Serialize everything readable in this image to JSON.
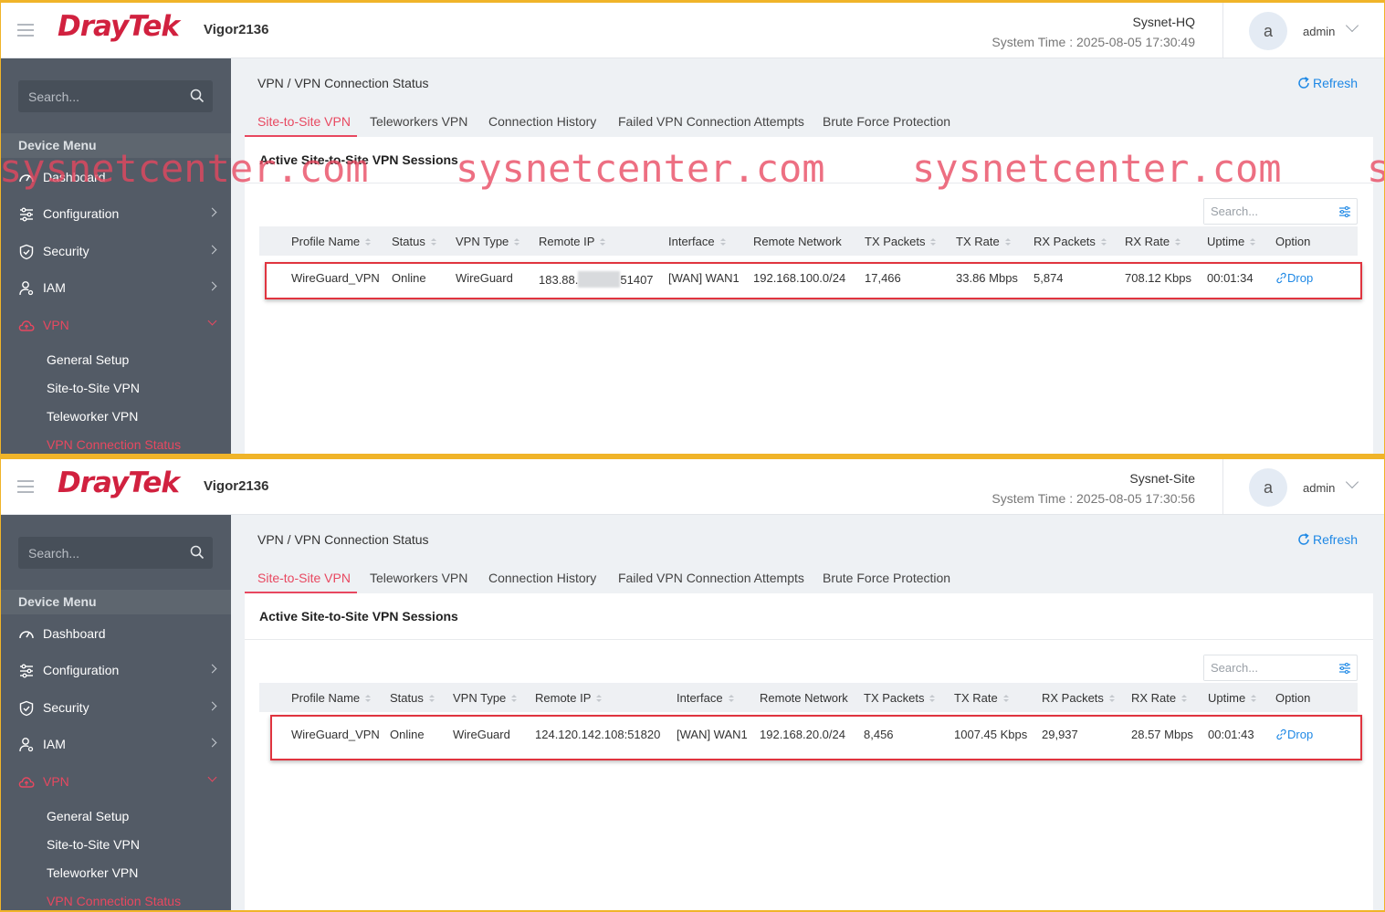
{
  "brand": {
    "logo": "DrayTek",
    "model": "Vigor2136"
  },
  "header": {
    "user_initial": "a",
    "user": "admin"
  },
  "sidebar": {
    "search_placeholder": "Search...",
    "section": "Device Menu",
    "items": [
      "Dashboard",
      "Configuration",
      "Security",
      "IAM",
      "VPN"
    ],
    "vpn_sub": [
      "General Setup",
      "Site-to-Site VPN",
      "Teleworker VPN",
      "VPN Connection Status"
    ]
  },
  "page": {
    "breadcrumb": "VPN / VPN Connection Status",
    "refresh": "Refresh",
    "tabs": [
      "Site-to-Site VPN",
      "Teleworkers VPN",
      "Connection History",
      "Failed VPN Connection Attempts",
      "Brute Force Protection"
    ],
    "active_tab": "Site-to-Site VPN",
    "card_title": "Active Site-to-Site VPN Sessions",
    "table_search_placeholder": "Search...",
    "columns": [
      "Profile Name",
      "Status",
      "VPN Type",
      "Remote IP",
      "Interface",
      "Remote Network",
      "TX Packets",
      "TX Rate",
      "RX Packets",
      "RX Rate",
      "Uptime",
      "Option"
    ]
  },
  "panels": [
    {
      "site": "Sysnet-HQ",
      "system_time": "System Time : 2025-08-05 17:30:49",
      "row": {
        "profile": "WireGuard_VPN",
        "status": "Online",
        "vpn_type": "WireGuard",
        "remote_ip_prefix": "183.88.",
        "remote_ip_suffix": "51407",
        "interface": "[WAN] WAN1",
        "remote_network": "192.168.100.0/24",
        "tx_packets": "17,466",
        "tx_rate": "33.86 Mbps",
        "rx_packets": "5,874",
        "rx_rate": "708.12 Kbps",
        "uptime": "00:01:34",
        "option": "Drop"
      }
    },
    {
      "site": "Sysnet-Site",
      "system_time": "System Time : 2025-08-05 17:30:56",
      "row": {
        "profile": "WireGuard_VPN",
        "status": "Online",
        "vpn_type": "WireGuard",
        "remote_ip": "124.120.142.108:51820",
        "interface": "[WAN] WAN1",
        "remote_network": "192.168.20.0/24",
        "tx_packets": "8,456",
        "tx_rate": "1007.45 Kbps",
        "rx_packets": "29,937",
        "rx_rate": "28.57 Mbps",
        "uptime": "00:01:43",
        "option": "Drop"
      }
    }
  ],
  "watermark": "sysnetcenter.com",
  "colors": {
    "brand": "#d1213f",
    "accent": "#e84860",
    "link": "#1e88e5",
    "sidebar": "#535b66",
    "highlight": "#e0343f"
  }
}
